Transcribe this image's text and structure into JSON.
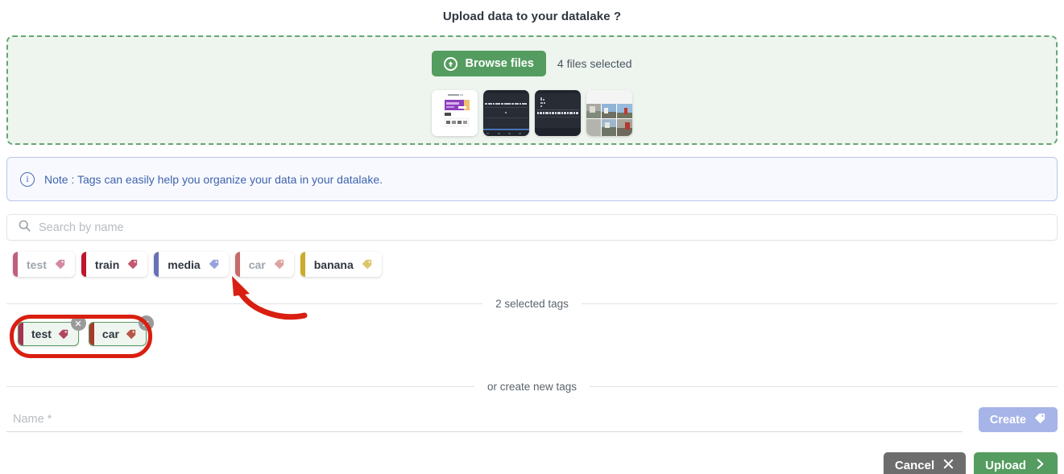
{
  "dialog": {
    "title": "Upload data to your datalake ?"
  },
  "dropzone": {
    "browse_label": "Browse files",
    "browse_icon": "upload-arrow-circle-icon",
    "files_selected": "4 files selected",
    "thumbnails": [
      {
        "name": "thumbnail-webpage-screenshot",
        "kind": "light-webpage"
      },
      {
        "name": "thumbnail-terminal-dark-1",
        "kind": "dark-terminal"
      },
      {
        "name": "thumbnail-terminal-dark-2",
        "kind": "dark-terminal-2"
      },
      {
        "name": "thumbnail-photo-grid",
        "kind": "photo-grid"
      }
    ]
  },
  "note": {
    "icon": "info-circle-icon",
    "icon_glyph": "i",
    "text": "Note : Tags can easily help you organize your data in your datalake."
  },
  "search": {
    "icon": "search-icon",
    "placeholder": "Search by name",
    "value": ""
  },
  "available_tags": [
    {
      "label": "test",
      "color": "#c0607c",
      "used": true,
      "icon": "tag-icon"
    },
    {
      "label": "train",
      "color": "#c0142f",
      "used": false,
      "icon": "tag-icon"
    },
    {
      "label": "media",
      "color": "#6771b8",
      "used": false,
      "icon": "tag-icon"
    },
    {
      "label": "car",
      "color": "#c96a6a",
      "used": true,
      "icon": "tag-icon"
    },
    {
      "label": "banana",
      "color": "#cbac2b",
      "used": false,
      "icon": "tag-icon"
    }
  ],
  "selected_section": {
    "divider_label": "2 selected tags",
    "tags": [
      {
        "label": "test",
        "color": "#a63351",
        "icon": "tag-icon",
        "remove_icon": "close-circle-icon"
      },
      {
        "label": "car",
        "color": "#a63a2b",
        "icon": "tag-icon",
        "remove_icon": "close-circle-icon"
      }
    ],
    "annotation_color": "#d91f11"
  },
  "create_section": {
    "divider_label": "or create new tags",
    "name_placeholder": "Name *",
    "name_value": "",
    "create_label": "Create",
    "create_icon": "tag-icon"
  },
  "footer": {
    "cancel_label": "Cancel",
    "cancel_icon": "close-x-icon",
    "upload_label": "Upload",
    "upload_icon": "chevron-right-icon"
  },
  "annotations": {
    "arrow_color": "#d91f11",
    "arrow_target": "car-tag-chip"
  },
  "colors": {
    "green_accent": "#549c5f",
    "note_blue": "#3f63ad",
    "annotation_red": "#d91f11"
  }
}
